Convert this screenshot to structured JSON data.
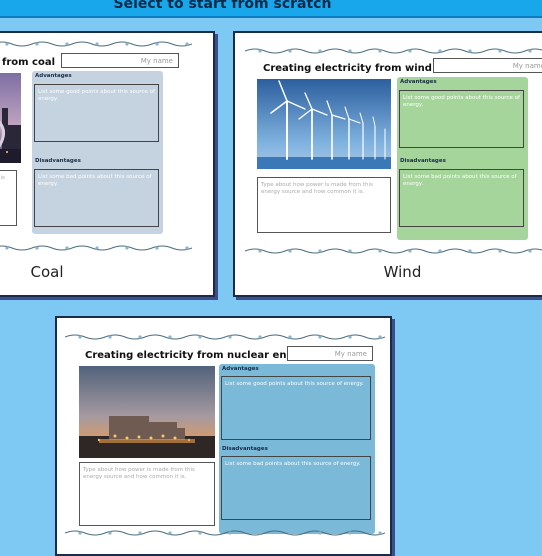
{
  "banner": {
    "title": "Select to start from scratch"
  },
  "cards": [
    {
      "label": "Coal",
      "title": "Creating electricity from coal",
      "name_placeholder": "My name",
      "advantages_heading": "Advantages",
      "advantages_text": "List some good points about this source of energy.",
      "disadvantages_heading": "Disadvantages",
      "disadvantages_text": "List some bad points about this source of energy.",
      "type_text": "Type about how power is made from this energy source and how common it is.",
      "panel_color": "#c4d3df",
      "box_color": "#c4d3df"
    },
    {
      "label": "Wind",
      "title": "Creating electricity from wind",
      "name_placeholder": "My name",
      "advantages_heading": "Advantages",
      "advantages_text": "List some good points about this source of energy.",
      "disadvantages_heading": "Disadvantages",
      "disadvantages_text": "List some bad points about this source of energy.",
      "type_text": "Type about how power is made from this energy source and how common it is.",
      "panel_color": "#a6d59b",
      "box_color": "#a6d59b"
    },
    {
      "title": "Creating electricity from nuclear energy",
      "name_placeholder": "My name",
      "advantages_heading": "Advantages",
      "advantages_text": "List some good points about this source of energy.",
      "disadvantages_heading": "Disadvantages",
      "disadvantages_text": "List some bad points about this source of energy.",
      "type_text": "Type about how power is made from this energy source and how common it is.",
      "panel_color": "#7ab9d8",
      "box_color": "#7ab9d8"
    }
  ]
}
